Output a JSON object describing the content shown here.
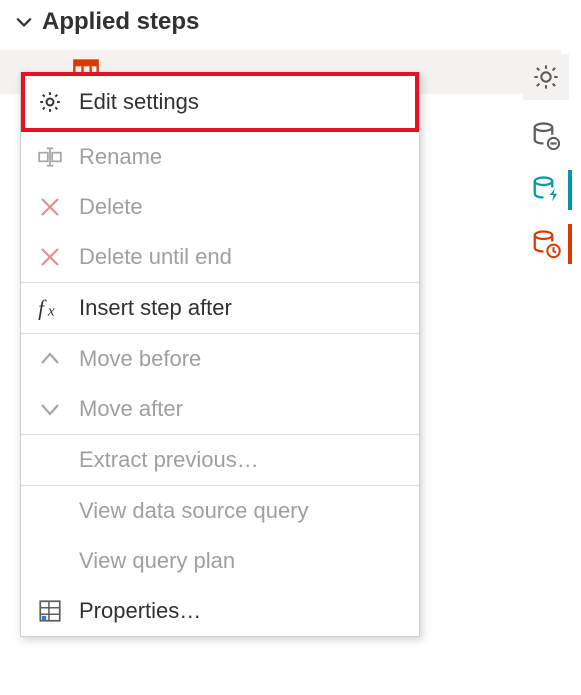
{
  "section": {
    "title": "Applied steps"
  },
  "menu": {
    "edit_settings": "Edit settings",
    "rename": "Rename",
    "delete": "Delete",
    "delete_until_end": "Delete until end",
    "insert_step_after": "Insert step after",
    "move_before": "Move before",
    "move_after": "Move after",
    "extract_previous": "Extract previous…",
    "view_data_source_query": "View data source query",
    "view_query_plan": "View query plan",
    "properties": "Properties…"
  }
}
